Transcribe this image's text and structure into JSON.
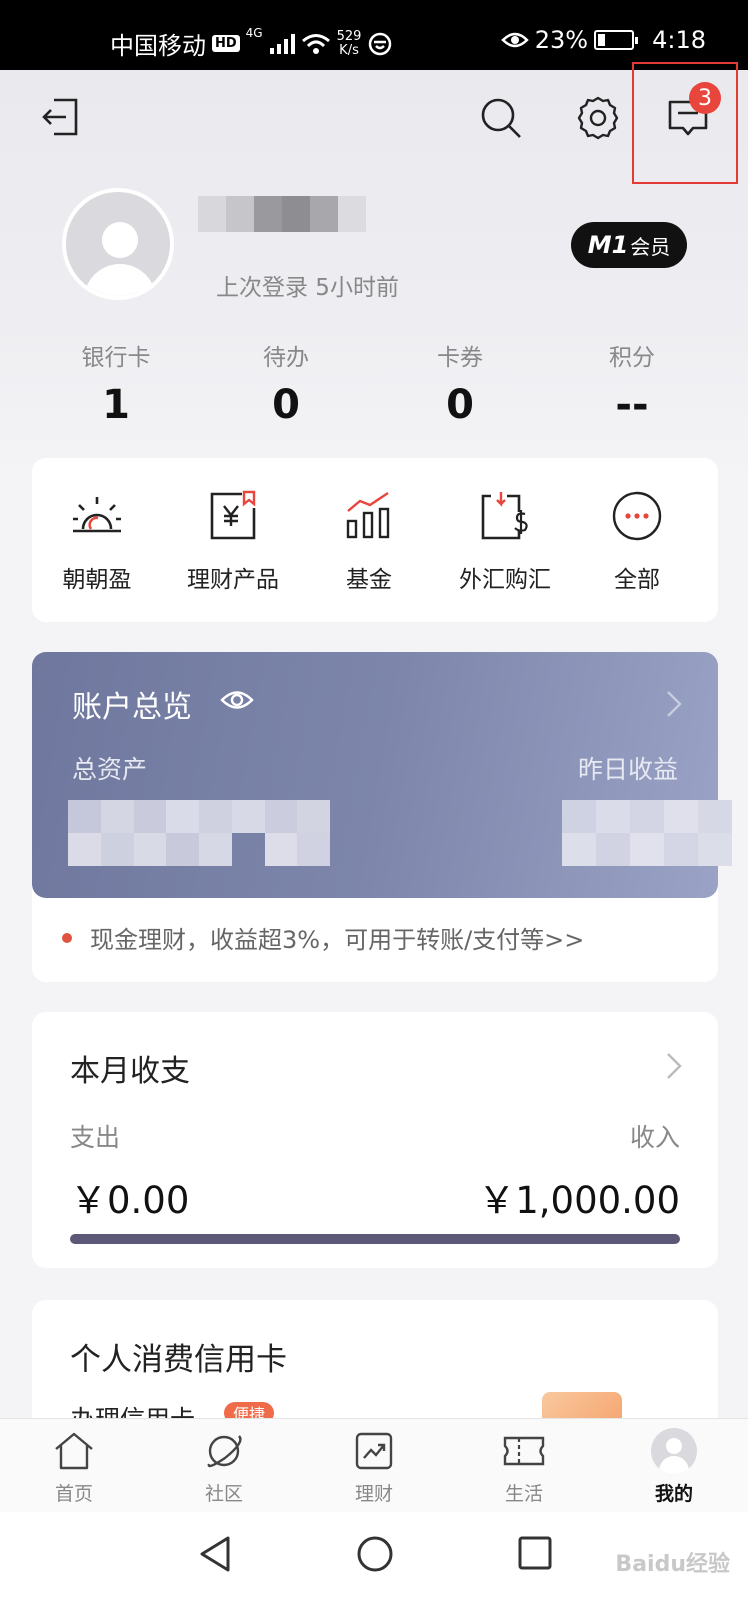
{
  "status_bar": {
    "carrier": "中国移动",
    "hd": "HD",
    "network": "4G",
    "speed_value": "529",
    "speed_unit": "K/s",
    "battery": "23%",
    "battery_level": 0.23,
    "time": "4:18"
  },
  "header": {
    "notification_count": "3",
    "last_login": "上次登录 5小时前",
    "member_level": "M1",
    "member_suffix": "会员",
    "stats": [
      {
        "label": "银行卡",
        "value": "1"
      },
      {
        "label": "待办",
        "value": "0"
      },
      {
        "label": "卡券",
        "value": "0"
      },
      {
        "label": "积分",
        "value": "--"
      }
    ]
  },
  "quick_actions": [
    {
      "label": "朝朝盈",
      "icon": "sunrise-icon"
    },
    {
      "label": "理财产品",
      "icon": "yuan-document-icon"
    },
    {
      "label": "基金",
      "icon": "bar-chart-icon"
    },
    {
      "label": "外汇购汇",
      "icon": "currency-exchange-icon"
    },
    {
      "label": "全部",
      "icon": "more-icon"
    }
  ],
  "account_overview": {
    "title": "账户总览",
    "total_assets_label": "总资产",
    "yesterday_income_label": "昨日收益",
    "promo": "现金理财，收益超3%，可用于转账/支付等>>"
  },
  "monthly": {
    "title": "本月收支",
    "expense_label": "支出",
    "income_label": "收入",
    "expense_value": "￥0.00",
    "income_value": "￥1,000.00"
  },
  "credit_card": {
    "title": "个人消费信用卡",
    "apply_label": "办理信用卡",
    "tag": "便捷"
  },
  "tab_bar": [
    {
      "label": "首页",
      "icon": "home-icon",
      "active": false
    },
    {
      "label": "社区",
      "icon": "planet-icon",
      "active": false
    },
    {
      "label": "理财",
      "icon": "trend-chart-icon",
      "active": false
    },
    {
      "label": "生活",
      "icon": "ticket-icon",
      "active": false
    },
    {
      "label": "我的",
      "icon": "avatar-icon",
      "active": true
    }
  ],
  "watermark": "Baidu经验",
  "colors": {
    "accent_red": "#e8453c",
    "account_card": "#7d86aa",
    "progress_bar": "#5b5878"
  }
}
